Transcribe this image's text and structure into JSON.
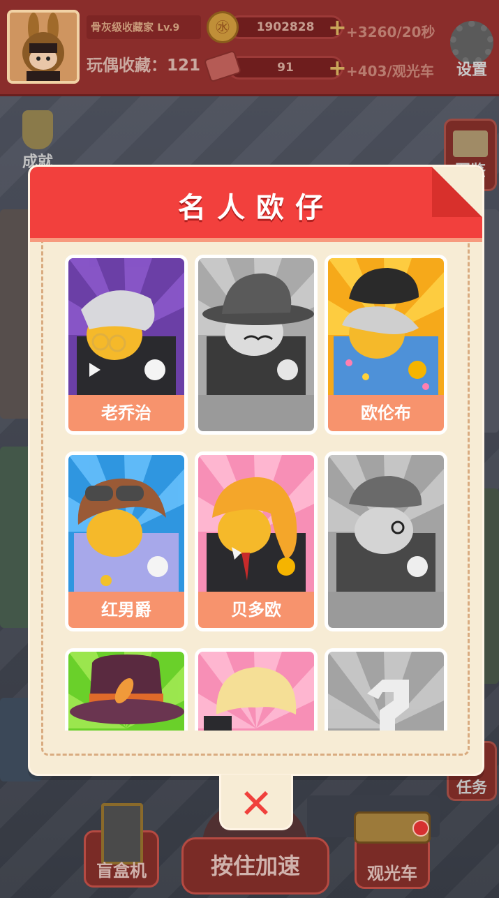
{
  "hud": {
    "title_rank": "骨灰级收藏家",
    "level": "Lv.9",
    "collection_label": "玩偶收藏：",
    "collection_count": "121",
    "coins": "1902828",
    "coin_rate": "+3260",
    "coin_rate_unit": "/20秒",
    "tickets": "91",
    "ticket_rate": "+403",
    "ticket_rate_unit": "/观光车",
    "settings_label": "设置"
  },
  "side": {
    "achievement": "成就",
    "atlas": "图鉴",
    "task": "任务"
  },
  "bottom": {
    "blindbox": "盲盒机",
    "speedup": "按住加速",
    "tour": "观光车"
  },
  "modal": {
    "title": "名人欧仔",
    "close_icon": "close-icon",
    "cards": [
      {
        "name": "老乔治",
        "locked": false
      },
      {
        "name": "",
        "locked": true
      },
      {
        "name": "欧伦布",
        "locked": false
      },
      {
        "name": "红男爵",
        "locked": false
      },
      {
        "name": "贝多欧",
        "locked": false
      },
      {
        "name": "",
        "locked": true
      },
      {
        "name": "",
        "locked": false
      },
      {
        "name": "",
        "locked": false
      },
      {
        "name": "",
        "locked": true
      }
    ]
  },
  "colors": {
    "header_red": "#f2403d",
    "name_bar": "#f7936d",
    "locked_bar": "#9a9a9a",
    "panel": "#f7ecd5"
  }
}
